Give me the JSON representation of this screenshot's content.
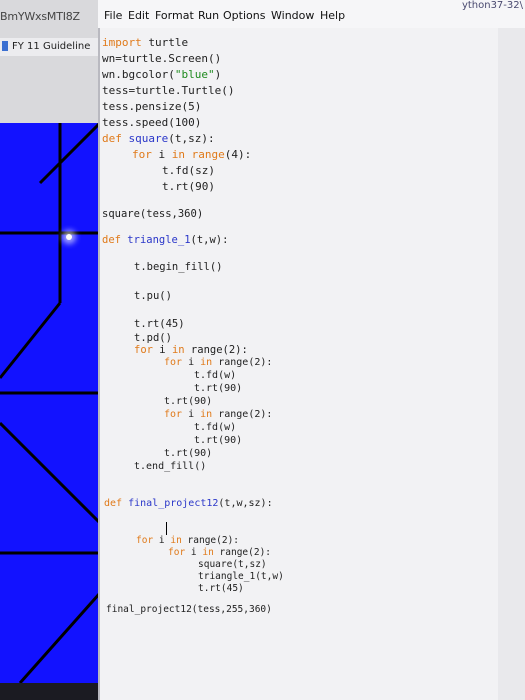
{
  "window": {
    "left_title": "BmYWxsMTI8Z",
    "top_right_text": "ython37-32\\"
  },
  "menubar": {
    "file": "File",
    "edit": "Edit",
    "format": "Format",
    "run": "Run",
    "options": "Options",
    "window": "Window",
    "help": "Help"
  },
  "left_tab": {
    "label": "FY 11 Guideline"
  },
  "colors": {
    "canvas_blue": "#1212ff",
    "keyword_orange": "#e07a1a",
    "definition_blue": "#2b37c9",
    "string_green": "#1e8a1e"
  },
  "code": {
    "l1_kw": "import",
    "l1_rest": " turtle",
    "l2": "wn=turtle.Screen()",
    "l3_a": "wn.bgcolor(",
    "l3_str": "\"blue\"",
    "l3_b": ")",
    "l4": "tess=turtle.Turtle()",
    "l5": "tess.pensize(5)",
    "l6": "tess.speed(100)",
    "l7_kw": "def",
    "l7_fn": "square",
    "l7_rest": "(t,sz):",
    "l8_kw1": "for",
    "l8_a": " i ",
    "l8_kw2": "in",
    "l8_kw3": "range",
    "l8_b": "(4):",
    "l9": "t.fd(sz)",
    "l10": "t.rt(90)",
    "l11": "square(tess,360)",
    "l12_kw": "def",
    "l12_fn": "triangle_1",
    "l12_rest": "(t,w):",
    "l13": "t.begin_fill()",
    "l14": "t.pu()",
    "l15": "t.rt(45)",
    "l16": "t.pd()",
    "l17_kw1": "for",
    "l17_a": " i ",
    "l17_kw2": "in",
    "l17_kw3": "range",
    "l17_b": "(2):",
    "l18_kw1": "for",
    "l18_a": " i ",
    "l18_kw2": "in",
    "l18_kw3": "range",
    "l18_b": "(2):",
    "l19": "t.fd(w)",
    "l20": "t.rt(90)",
    "l21": "t.rt(90)",
    "l22_kw1": "for",
    "l22_a": " i ",
    "l22_kw2": "in",
    "l22_kw3": "range",
    "l22_b": "(2):",
    "l23": "t.fd(w)",
    "l24": "t.rt(90)",
    "l25": "t.rt(90)",
    "l26": "t.end_fill()",
    "l27_kw": "def",
    "l27_fn": "final_project12",
    "l27_rest": "(t,w,sz):",
    "l28_kw1": "for",
    "l28_a": " i ",
    "l28_kw2": "in",
    "l28_kw3": "range",
    "l28_b": "(2):",
    "l29_kw1": "for",
    "l29_a": " i ",
    "l29_kw2": "in",
    "l29_kw3": "range",
    "l29_b": "(2):",
    "l30": "square(t,sz)",
    "l31": "triangle_1(t,w)",
    "l32": "t.rt(45)",
    "l33": "final_project12(tess,255,360)"
  }
}
